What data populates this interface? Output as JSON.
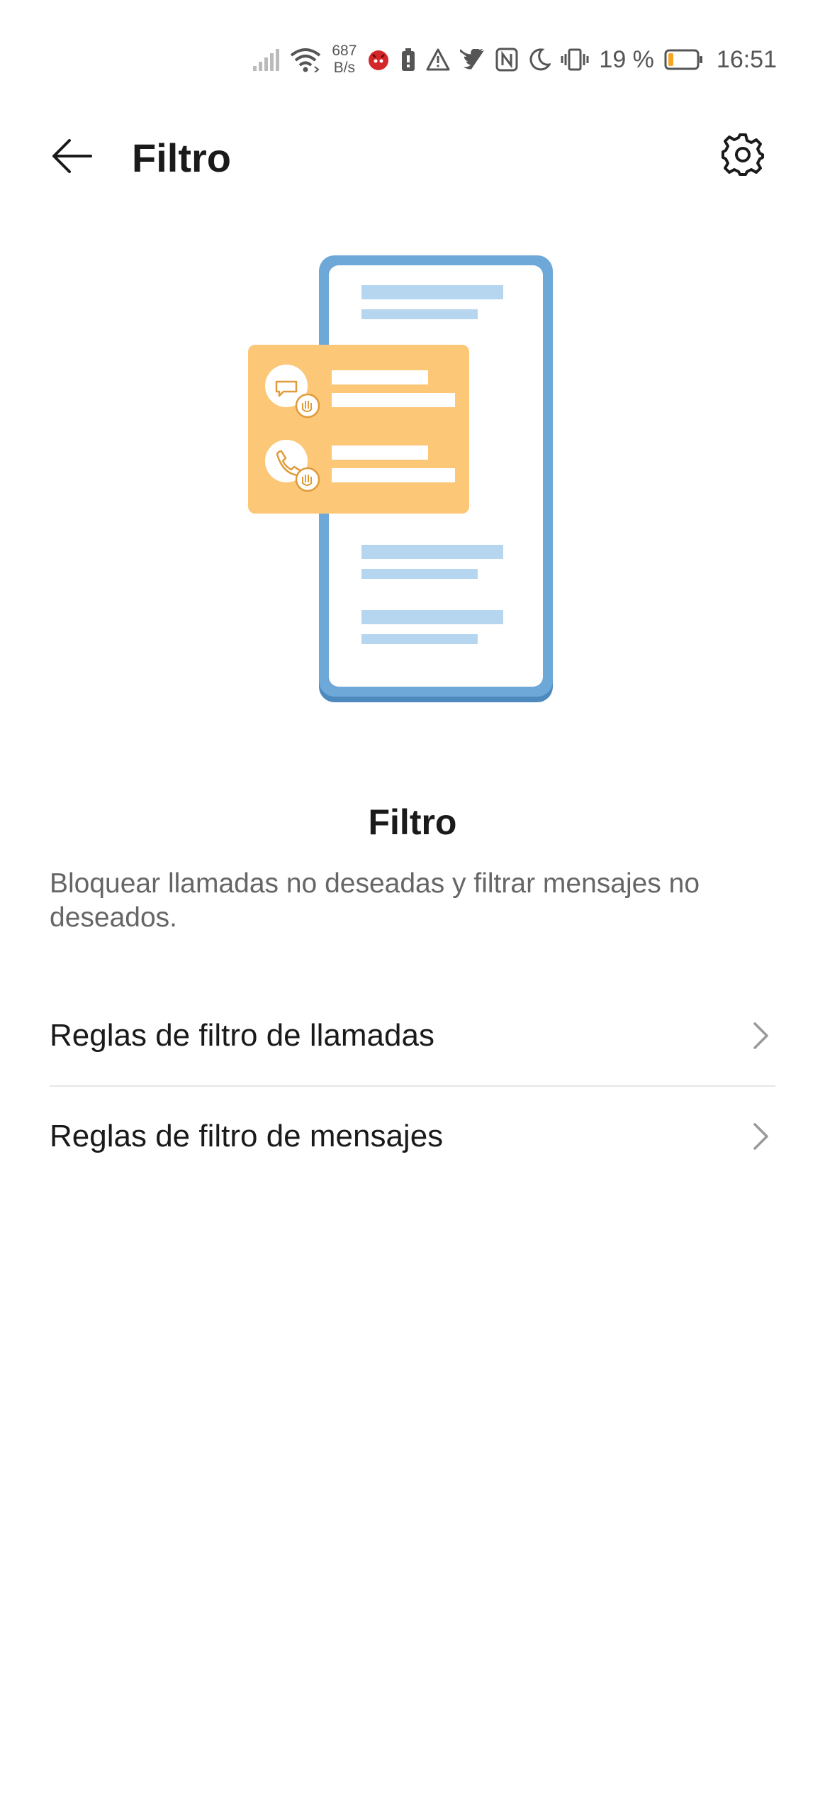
{
  "status_bar": {
    "net_speed_value": "687",
    "net_speed_unit": "B/s",
    "battery_percent": "19 %",
    "time": "16:51",
    "battery_level": 0.19,
    "icons": [
      "signal-icon",
      "wifi-icon",
      "app-notification-icon",
      "battery-saver-icon",
      "warning-icon",
      "twitter-icon",
      "nfc-icon",
      "do-not-disturb-icon",
      "vibrate-icon",
      "battery-icon"
    ]
  },
  "app_bar": {
    "title": "Filtro",
    "back_icon": "arrow-left-icon",
    "settings_icon": "gear-icon"
  },
  "intro": {
    "title": "Filtro",
    "description": "Bloquear llamadas no deseadas y filtrar mensajes no deseados."
  },
  "list": {
    "items": [
      {
        "label": "Reglas de filtro de llamadas",
        "icon": "chevron-right-icon"
      },
      {
        "label": "Reglas de filtro de mensajes",
        "icon": "chevron-right-icon"
      }
    ]
  },
  "colors": {
    "phone_frame": "#6ea8d8",
    "phone_lines": "#b6d6f0",
    "card": "#fcc777",
    "accent_icon": "#e09b3a",
    "battery_fill": "#f5a623"
  }
}
